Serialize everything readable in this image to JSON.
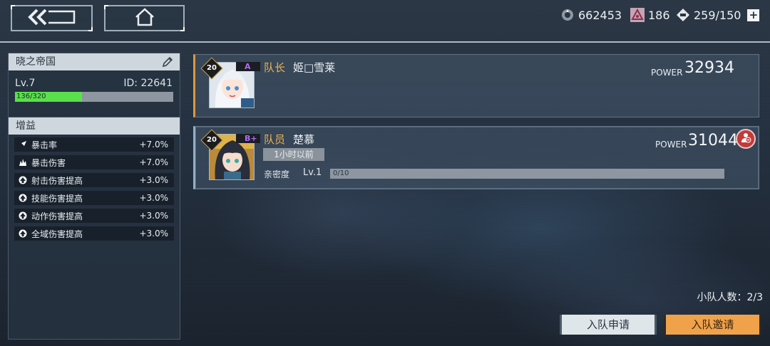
{
  "resources": [
    {
      "name": "coin",
      "value": "662453"
    },
    {
      "name": "crystal",
      "value": "186"
    },
    {
      "name": "stamina",
      "value": "259/150"
    }
  ],
  "profile": {
    "guild_name": "晓之帝国",
    "level": "Lv.7",
    "id": "ID: 22641",
    "exp_text": "136/320",
    "exp_fraction": 0.425
  },
  "buffs": {
    "title": "增益",
    "items": [
      {
        "label": "暴击率",
        "value": "+7.0%",
        "icon": "crit-rate-icon"
      },
      {
        "label": "暴击伤害",
        "value": "+7.0%",
        "icon": "crit-damage-icon"
      },
      {
        "label": "射击伤害提高",
        "value": "+3.0%",
        "icon": "up-arrow-icon"
      },
      {
        "label": "技能伤害提高",
        "value": "+3.0%",
        "icon": "up-arrow-icon"
      },
      {
        "label": "动作伤害提高",
        "value": "+3.0%",
        "icon": "up-arrow-icon"
      },
      {
        "label": "全域伤害提高",
        "value": "+3.0%",
        "icon": "up-arrow-icon"
      }
    ]
  },
  "members": [
    {
      "level": "20",
      "rank": "A",
      "role": "队长",
      "name": "姬□雪莱",
      "power_label": "POWER",
      "power": "32934"
    },
    {
      "level": "20",
      "rank": "B+",
      "role": "队员",
      "name": "楚慕",
      "power_label": "POWER",
      "power": "31044",
      "last_seen": "1小时以前",
      "affinity_label": "亲密度",
      "affinity_level": "Lv.1",
      "affinity_text": "0/10"
    }
  ],
  "team_count": "小队人数：2/3",
  "buttons": {
    "apply": "入队申请",
    "invite": "入队邀请"
  },
  "colors": {
    "accent_orange": "#f0a24a",
    "exp_green": "#59e04b",
    "kick_red": "#c23a3a"
  }
}
